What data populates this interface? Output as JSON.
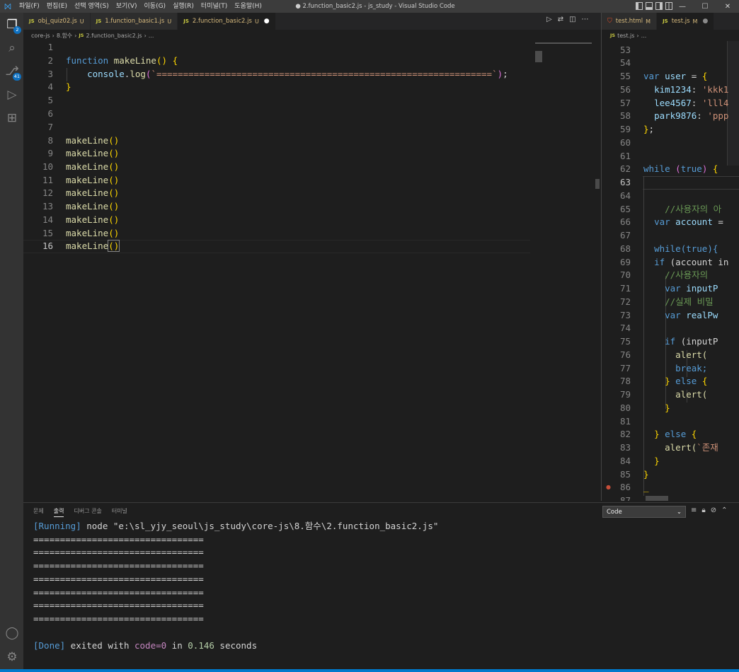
{
  "titlebar": {
    "menus": [
      "파일(F)",
      "편집(E)",
      "선택 영역(S)",
      "보기(V)",
      "이동(G)",
      "실행(R)",
      "터미널(T)",
      "도움말(H)"
    ],
    "window_title": "● 2.function_basic2.js - js_study - Visual Studio Code"
  },
  "activity": {
    "explorer_badge": "2",
    "scm_badge": "41"
  },
  "left_tabs": [
    {
      "name": "obj_quiz02.js",
      "status": "U"
    },
    {
      "name": "1.function_basic1.js",
      "status": "U"
    },
    {
      "name": "2.function_basic2.js",
      "status": "U"
    }
  ],
  "left_breadcrumb": [
    "core-js",
    "8.함수",
    "2.function_basic2.js",
    "..."
  ],
  "right_tabs": [
    {
      "name": "test.html",
      "status": "M"
    },
    {
      "name": "test.js",
      "status": "M"
    }
  ],
  "right_breadcrumb": [
    "test.js",
    "..."
  ],
  "left_editor": {
    "line_numbers": [
      "1",
      "2",
      "3",
      "4",
      "5",
      "6",
      "7",
      "8",
      "9",
      "10",
      "11",
      "12",
      "13",
      "14",
      "15",
      "16"
    ],
    "current_line": "16",
    "code": {
      "l2_kw": "function",
      "l2_fn": "makeLine",
      "l3_obj": "console",
      "l3_method": "log",
      "l3_str": "`===============================================================`",
      "call": "makeLine"
    }
  },
  "right_editor": {
    "line_numbers": [
      "53",
      "54",
      "55",
      "56",
      "57",
      "58",
      "59",
      "60",
      "61",
      "62",
      "63",
      "64",
      "65",
      "66",
      "67",
      "68",
      "69",
      "70",
      "71",
      "72",
      "73",
      "74",
      "75",
      "76",
      "77",
      "78",
      "79",
      "80",
      "81",
      "82",
      "83",
      "84",
      "85",
      "86",
      "87"
    ],
    "current_line": "63",
    "code": {
      "var_kw": "var",
      "user": "user",
      "k1": "kim1234",
      "v1": "'kkk1",
      "k2": "lee4567",
      "v2": "'lll4",
      "k3": "park9876",
      "v3": "'ppp",
      "while_kw": "while",
      "true_kw": "true",
      "comment1": "//사용자의 아",
      "account": "account",
      "while2": "while(true){",
      "if_kw": "if",
      "account_in": "(account in",
      "comment2": "//사용자의",
      "inputP": "inputP",
      "comment3": "//실제 비밀",
      "realPw": "realPw",
      "if_inputP": "(inputP",
      "alert1": "alert(",
      "break_kw": "break;",
      "else_kw": "else",
      "alert2": "alert(",
      "alert3_str": "`존재"
    }
  },
  "panel": {
    "tabs": [
      "문제",
      "출력",
      "디버그 콘솔",
      "터미널"
    ],
    "channel": "Code",
    "running_tag": "[Running]",
    "running_cmd": " node \"e:\\sl_yjy_seoul\\js_study\\core-js\\8.함수\\2.function_basic2.js\"",
    "separator": "================================",
    "done_tag": "[Done]",
    "done_text_1": " exited with ",
    "done_code": "code=0",
    "done_text_2": " in ",
    "done_time": "0.146",
    "done_text_3": " seconds"
  }
}
